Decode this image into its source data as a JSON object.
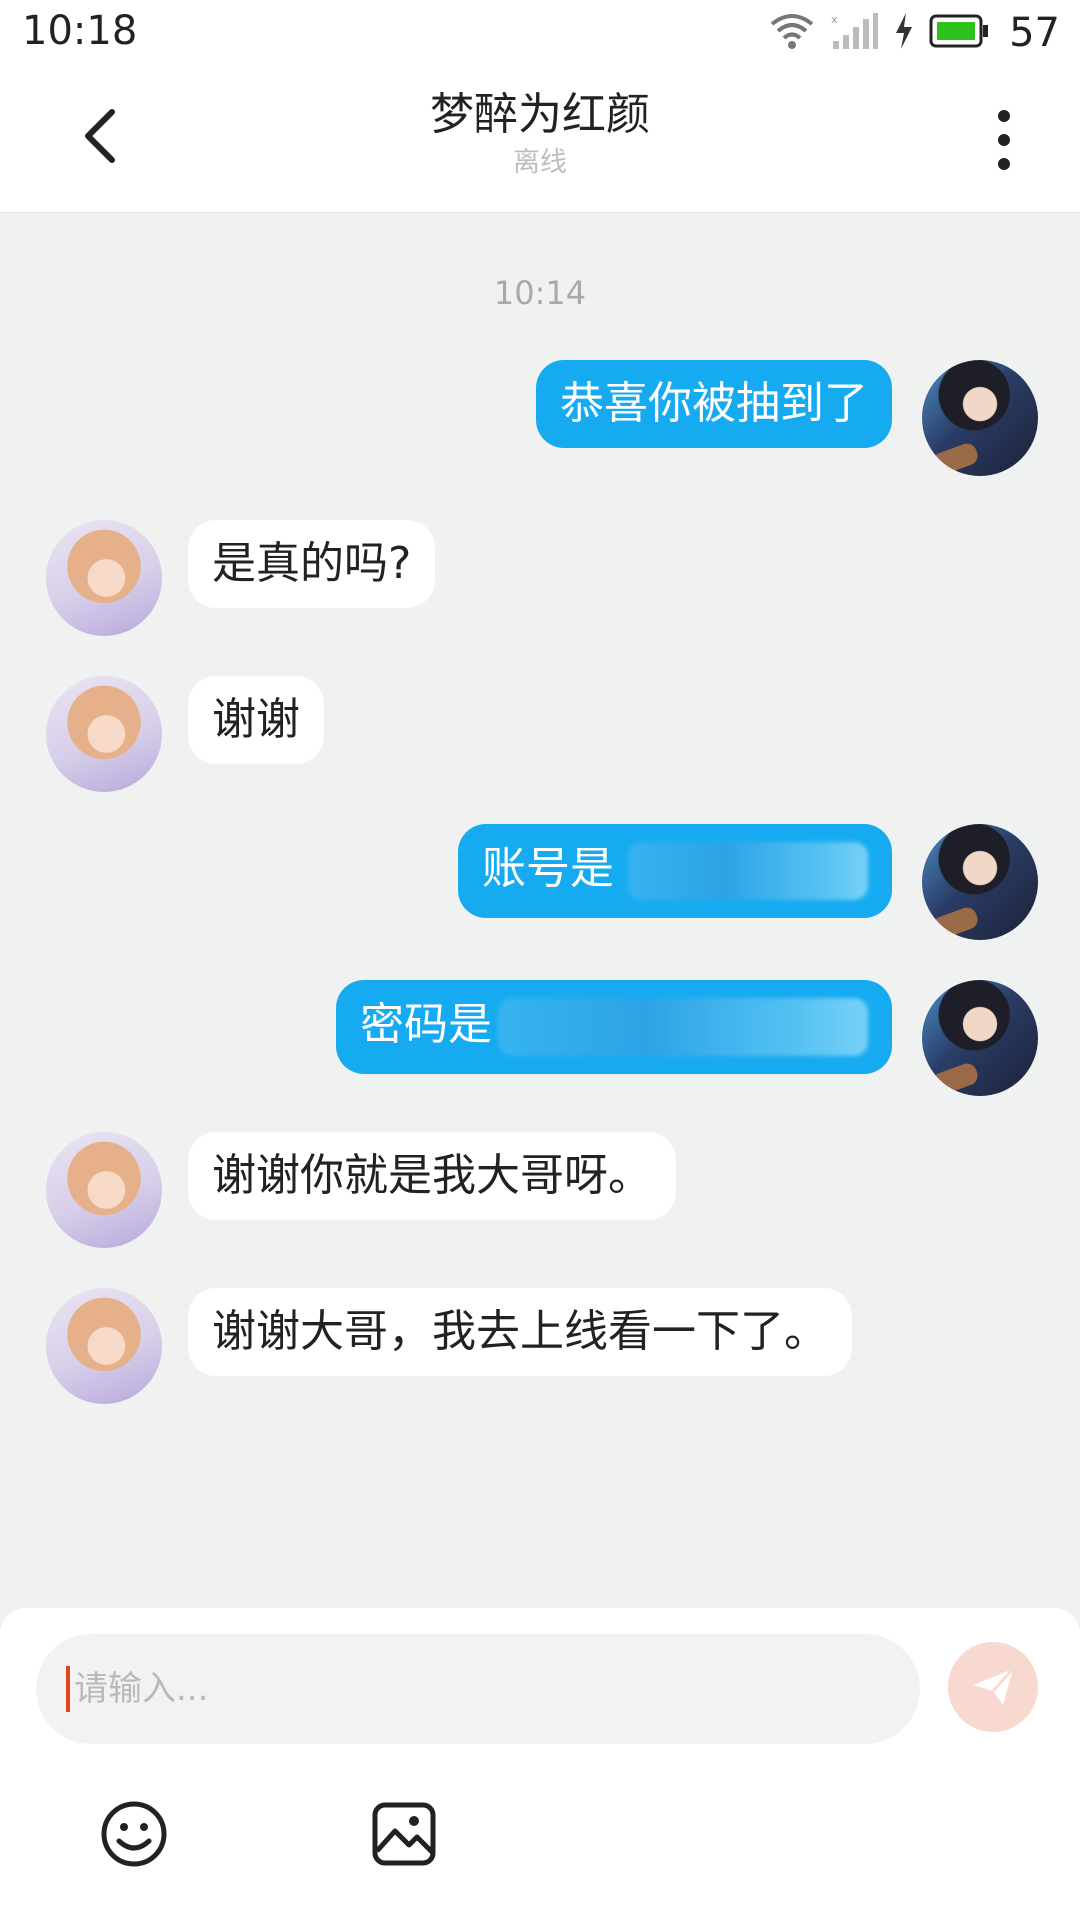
{
  "status_bar": {
    "time": "10:18",
    "battery_level": "57",
    "icons": [
      "wifi-icon",
      "signal-icon",
      "charging-icon",
      "battery-icon"
    ]
  },
  "header": {
    "back_icon": "chevron-left-icon",
    "title": "梦醉为红颜",
    "subtitle": "离线",
    "more_icon": "more-vertical-icon"
  },
  "chat": {
    "timestamp": "10:14",
    "messages": [
      {
        "side": "right",
        "text": "恭喜你被抽到了"
      },
      {
        "side": "left",
        "text": "是真的吗?"
      },
      {
        "side": "left",
        "text": "谢谢"
      },
      {
        "side": "right",
        "text": "账号是"
      },
      {
        "side": "right",
        "text": "密码是"
      },
      {
        "side": "left",
        "text": "谢谢你就是我大哥呀。"
      },
      {
        "side": "left",
        "text": "谢谢大哥，我去上线看一下了。"
      }
    ]
  },
  "input_bar": {
    "placeholder": "请输入...",
    "value": "",
    "send_icon": "send-icon",
    "tools": [
      "emoji-icon",
      "image-icon"
    ]
  },
  "colors": {
    "outgoing_bubble": "#16abf0",
    "incoming_bubble": "#ffffff",
    "chat_background": "#f0f2f2",
    "send_button": "#f8d9cf",
    "cursor": "#e0451b"
  }
}
